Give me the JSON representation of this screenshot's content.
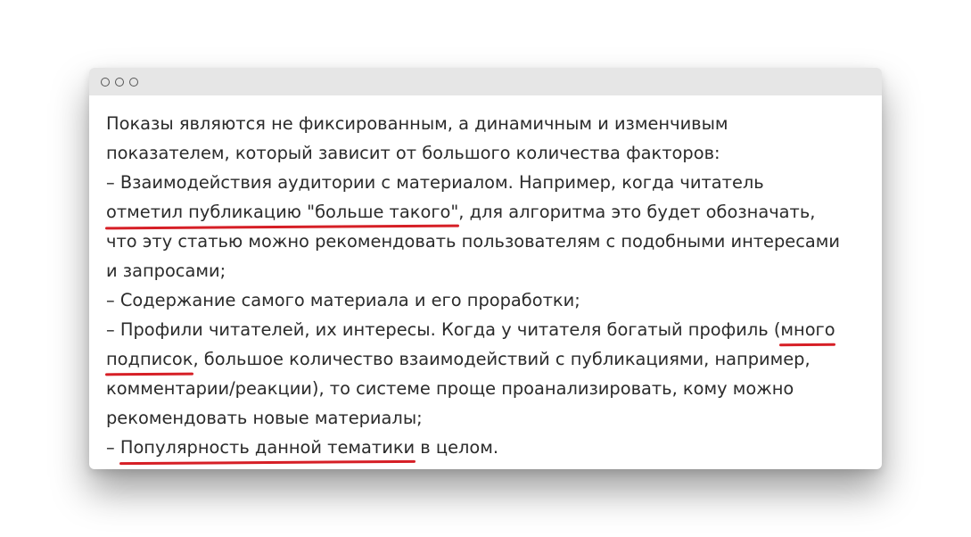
{
  "window": {
    "controls": [
      "circle",
      "circle",
      "circle"
    ]
  },
  "text": {
    "l1": "Показы являются не фиксированным, а динамичным и изменчивым",
    "l2": "показателем, который зависит от большого количества факторов:",
    "l3": "– Взаимодействия аудитории с материалом. Например, когда читатель",
    "l4_hl": "отметил публикацию \"больше такого\"",
    "l4_rest": ", для алгоритма это будет обозначать,",
    "l5": "что эту статью можно рекомендовать пользователям с подобными интересами",
    "l6": "и запросами;",
    "l7": "– Содержание самого материала и его проработки;",
    "l8_pre": "– Профили читателей, их интересы. Когда у читателя богатый профиль (",
    "l8_hl": "много",
    "l9_hl": "подписок",
    "l9_rest": ", большое количество взаимодействий с публикациями, например,",
    "l10": "комментарии/реакции), то системе проще проанализировать, кому можно",
    "l11": "рекомендовать новые материалы;",
    "l12_pre": "– ",
    "l12_hl": "Популярность данной тематики",
    "l12_rest": " в целом."
  },
  "colors": {
    "underline": "#d61f26",
    "titlebar": "#e6e6e6",
    "text": "#2b2b2b"
  }
}
